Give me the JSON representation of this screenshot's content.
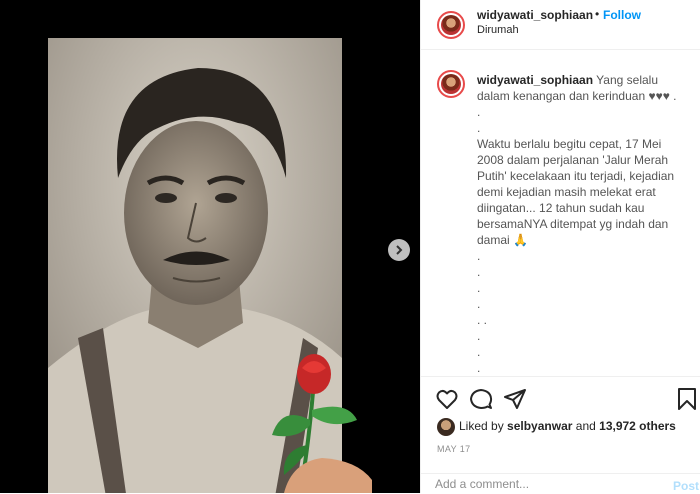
{
  "post": {
    "username": "widyawati_sophiaan",
    "follow_label": "Follow",
    "separator": "•",
    "location": "Dirumah"
  },
  "caption": {
    "username": "widyawati_sophiaan",
    "line1": "Yang selalu dalam kenangan dan kerinduan ♥♥♥ .",
    "dots_a": [
      ".",
      "."
    ],
    "body": "Waktu berlalu begitu cepat, 17 Mei 2008 dalam perjalanan 'Jalur Merah Putih' kecelakaan itu terjadi, kejadian demi kejadian masih melekat erat diingatan... 12 tahun sudah kau bersamaNYA ditempat yg indah dan damai 🙏",
    "dots_b": [
      ".",
      ".",
      ".",
      ".",
      ". .",
      ".",
      ".",
      ".",
      "."
    ]
  },
  "likes": {
    "prefix": "Liked by",
    "user": "selbyanwar",
    "and": "and",
    "count": "13,972 others"
  },
  "date": "MAY 17",
  "comment": {
    "placeholder": "Add a comment...",
    "post_label": "Post"
  },
  "icons": {
    "like": "heart-icon",
    "comment": "comment-icon",
    "share": "share-icon",
    "save": "bookmark-icon",
    "next": "chevron-right-icon"
  }
}
